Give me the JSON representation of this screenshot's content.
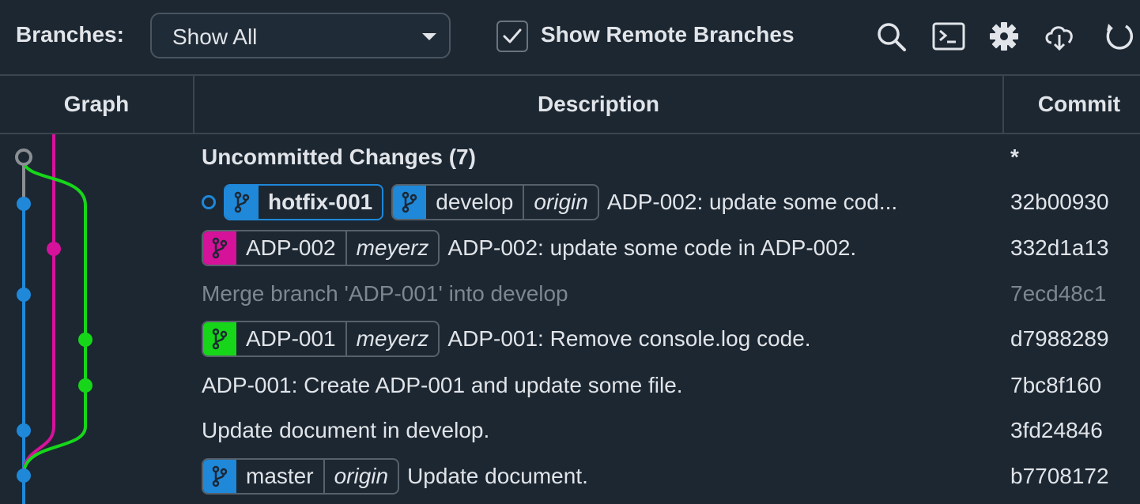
{
  "toolbar": {
    "branches_label": "Branches:",
    "branch_filter_value": "Show All",
    "show_remote_label": "Show Remote Branches",
    "show_remote_checked": true,
    "icons": [
      "search-icon",
      "terminal-icon",
      "gear-icon",
      "cloud-download-icon",
      "refresh-icon"
    ]
  },
  "columns": {
    "graph": "Graph",
    "description": "Description",
    "commit": "Commit"
  },
  "colors": {
    "blue": "#1f88d9",
    "magenta": "#d6119a",
    "green": "#17d61a",
    "gray": "#8a8f94",
    "background": "#1c2732"
  },
  "commits": [
    {
      "message": "Uncommitted Changes (7)",
      "hash": "*",
      "uncommitted": true
    },
    {
      "message": "ADP-002: update some cod...",
      "hash": "32b00930",
      "head": true,
      "refs": [
        {
          "name": "hotfix-001",
          "color": "#1f88d9",
          "head": true
        },
        {
          "name": "develop",
          "color": "#1f88d9",
          "remote": "origin"
        }
      ]
    },
    {
      "message": "ADP-002: update some code in ADP-002.",
      "hash": "332d1a13",
      "refs": [
        {
          "name": "ADP-002",
          "color": "#d6119a",
          "remote": "meyerz"
        }
      ]
    },
    {
      "message": "Merge branch 'ADP-001' into develop",
      "hash": "7ecd48c1",
      "dimmed": true
    },
    {
      "message": "ADP-001: Remove console.log code.",
      "hash": "d7988289",
      "refs": [
        {
          "name": "ADP-001",
          "color": "#17d61a",
          "remote": "meyerz"
        }
      ]
    },
    {
      "message": "ADP-001: Create ADP-001 and update some file.",
      "hash": "7bc8f160"
    },
    {
      "message": "Update document in develop.",
      "hash": "3fd24846"
    },
    {
      "message": "Update document.",
      "hash": "b7708172",
      "refs": [
        {
          "name": "master",
          "color": "#1f88d9",
          "remote": "origin"
        }
      ]
    }
  ]
}
